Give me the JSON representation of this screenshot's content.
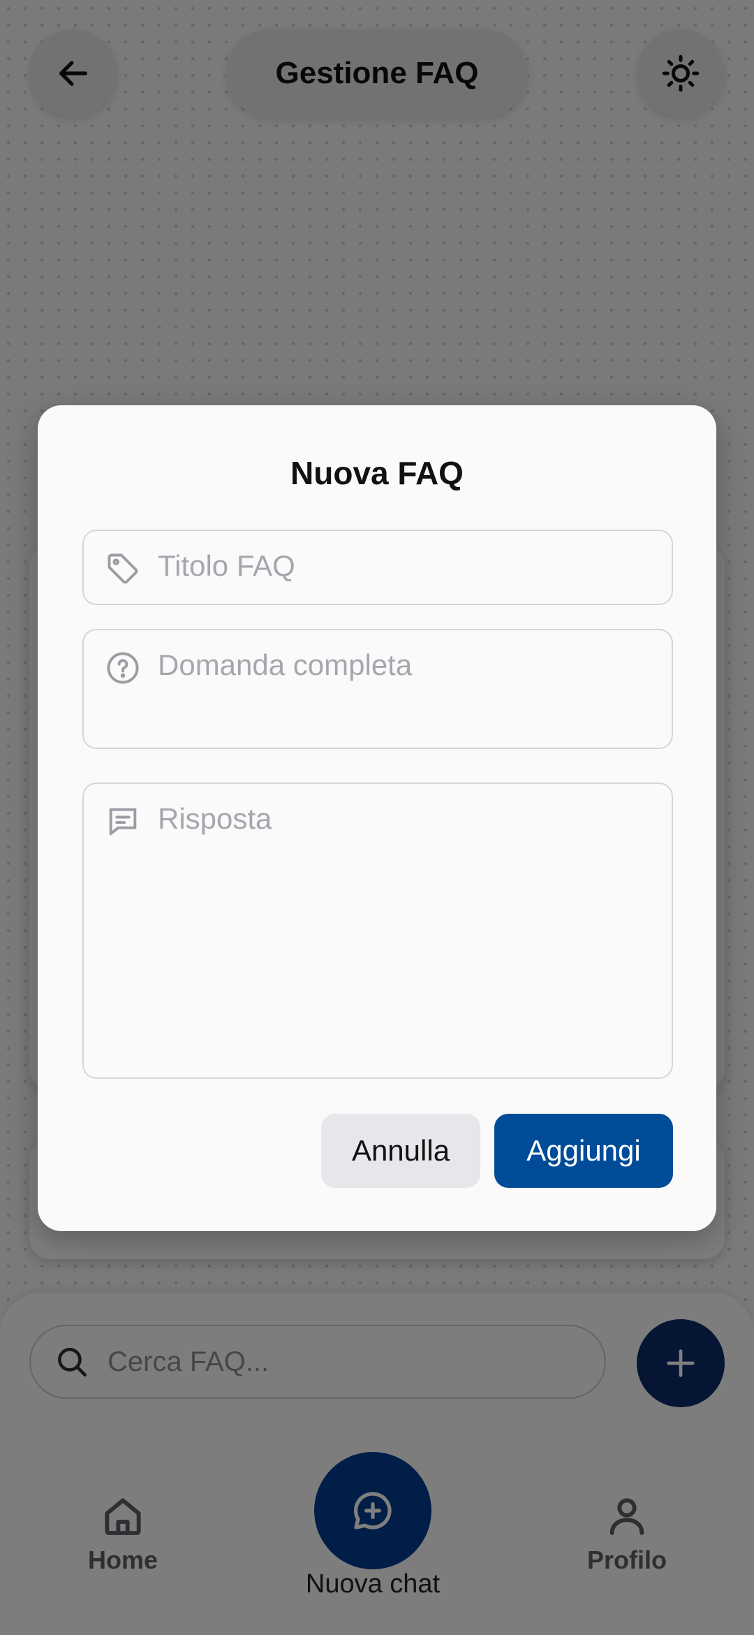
{
  "header": {
    "title": "Gestione FAQ",
    "back_icon": "arrow-left-icon",
    "theme_icon": "sun-icon"
  },
  "search": {
    "placeholder": "Cerca FAQ..."
  },
  "nav": {
    "home_label": "Home",
    "new_chat_label": "Nuova chat",
    "profile_label": "Profilo"
  },
  "modal": {
    "title": "Nuova FAQ",
    "title_placeholder": "Titolo FAQ",
    "question_placeholder": "Domanda completa",
    "answer_placeholder": "Risposta",
    "cancel_label": "Annulla",
    "add_label": "Aggiungi"
  },
  "colors": {
    "primary": "#004c99",
    "fab_dark": "#0a2a66",
    "overlay": "rgba(0,0,0,0.5)"
  }
}
